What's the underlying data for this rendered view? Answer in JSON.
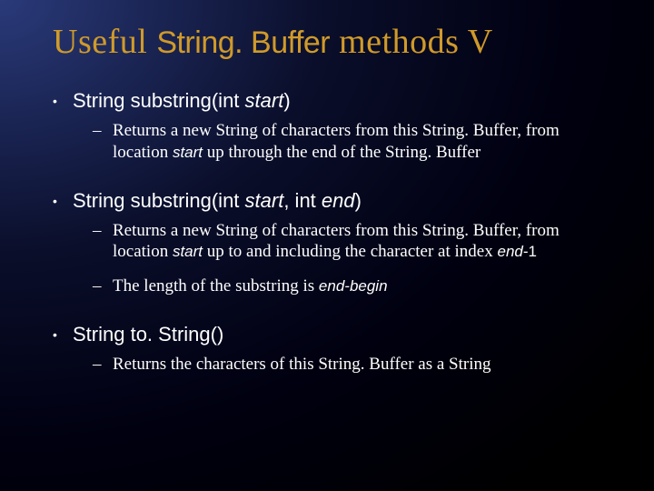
{
  "title": {
    "pre": "Useful ",
    "mono": "String. Buffer",
    "post": " methods V"
  },
  "items": [
    {
      "sig_pre": "String substring(int ",
      "sig_ital": "start",
      "sig_post": ")",
      "subs": [
        {
          "t1": "Returns a new String of characters from this String. Buffer, from location ",
          "i1": "start",
          "t2": " up through the end of the String. Buffer"
        }
      ]
    },
    {
      "sig_pre": "String substring(int ",
      "sig_ital": "start",
      "sig_mid": ", int ",
      "sig_ital2": "end",
      "sig_post": ")",
      "subs": [
        {
          "t1": "Returns a new String of characters from this String. Buffer, from location ",
          "i1": "start",
          "t2": " up to and including the character at index ",
          "i2": "end",
          "t3": "-1"
        },
        {
          "t1": "The length of the substring is ",
          "i1": "end-begin"
        }
      ]
    },
    {
      "sig_pre": "String to. String()",
      "subs": [
        {
          "t1": "Returns the characters of this String. Buffer as a String"
        }
      ]
    }
  ]
}
